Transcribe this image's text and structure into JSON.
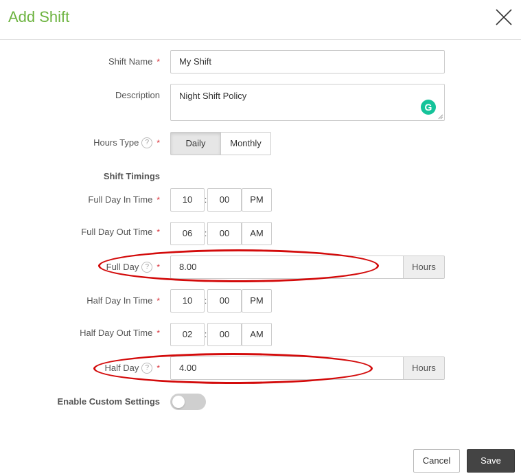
{
  "dialog": {
    "title": "Add Shift"
  },
  "form": {
    "shift_name": {
      "label": "Shift Name",
      "value": "My Shift"
    },
    "description": {
      "label": "Description",
      "value": "Night Shift Policy"
    },
    "hours_type": {
      "label": "Hours Type",
      "options": [
        "Daily",
        "Monthly"
      ],
      "selected": "Daily"
    },
    "shift_timings": {
      "heading": "Shift Timings"
    },
    "full_day_in": {
      "label": "Full Day In Time",
      "hour": "10",
      "minute": "00",
      "ampm": "PM"
    },
    "full_day_out": {
      "label": "Full Day Out Time",
      "hour": "06",
      "minute": "00",
      "ampm": "AM"
    },
    "full_day": {
      "label": "Full Day",
      "value": "8.00",
      "unit": "Hours"
    },
    "half_day_in": {
      "label": "Half Day In Time",
      "hour": "10",
      "minute": "00",
      "ampm": "PM"
    },
    "half_day_out": {
      "label": "Half Day Out Time",
      "hour": "02",
      "minute": "00",
      "ampm": "AM"
    },
    "half_day": {
      "label": "Half Day",
      "value": "4.00",
      "unit": "Hours"
    },
    "custom_settings": {
      "label": "Enable Custom Settings",
      "enabled": false
    }
  },
  "common": {
    "required_mark": "*",
    "help_mark": "?",
    "colon": ":",
    "grammarly_mark": "G"
  },
  "actions": {
    "cancel": "Cancel",
    "save": "Save"
  },
  "icons": {
    "close": "close-icon",
    "help": "help-icon",
    "grammarly": "grammarly-icon"
  },
  "colors": {
    "title": "#6cb33f",
    "required": "#d9313a",
    "highlight": "#d30b0b",
    "save_bg": "#444444"
  }
}
